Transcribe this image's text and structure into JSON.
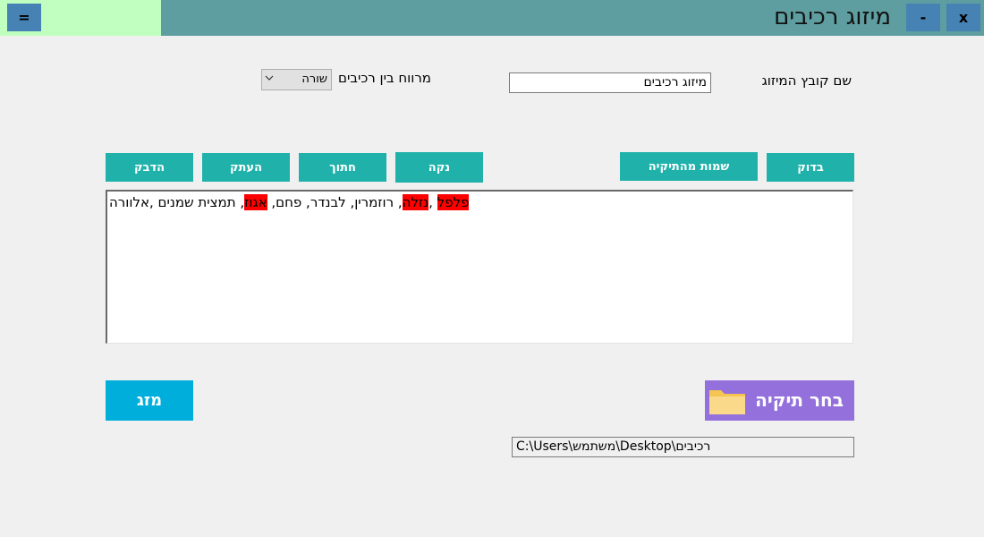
{
  "window": {
    "title": "מיזוג רכיבים",
    "menu_label": "=",
    "minimize_label": "-",
    "close_label": "x"
  },
  "form": {
    "file_name_label": "שם קובץ המיזוג",
    "file_name_value": "מיזוג רכיבים",
    "spacing_label": "מרווח בין רכיבים",
    "spacing_selected": "שורה"
  },
  "toolbar": {
    "check_label": "בדוק",
    "names_from_folder_label": "שמות מהתיקיה",
    "clear_label": "נקה",
    "cut_label": "חתוך",
    "copy_label": "העתק",
    "paste_label": "הדבק"
  },
  "editor": {
    "segments": [
      {
        "text": "פלפל",
        "highlight": true
      },
      {
        "text": " ,",
        "highlight": false
      },
      {
        "text": "נזלה",
        "highlight": true
      },
      {
        "text": ", רוזמרין, לבנדר, פחם, ",
        "highlight": false
      },
      {
        "text": "אגוז",
        "highlight": true
      },
      {
        "text": ", תמצית שמנים ,אלוורה",
        "highlight": false
      }
    ]
  },
  "actions": {
    "mix_label": "מזג",
    "choose_folder_label": "בחר תיקיה",
    "folder_path": "C:\\Users\\משתמש\\Desktop\\רכיבים"
  },
  "colors": {
    "titlebar": "#5f9ea0",
    "title_left": "#c0ffc0",
    "window_buttons": "#4682b4",
    "toolbar_buttons": "#20b2aa",
    "mix_button": "#00aedb",
    "folder_button": "#9370db",
    "highlight": "#ff0000"
  },
  "icons": {
    "folder": "folder-icon",
    "dropdown": "chevron-down-icon"
  }
}
